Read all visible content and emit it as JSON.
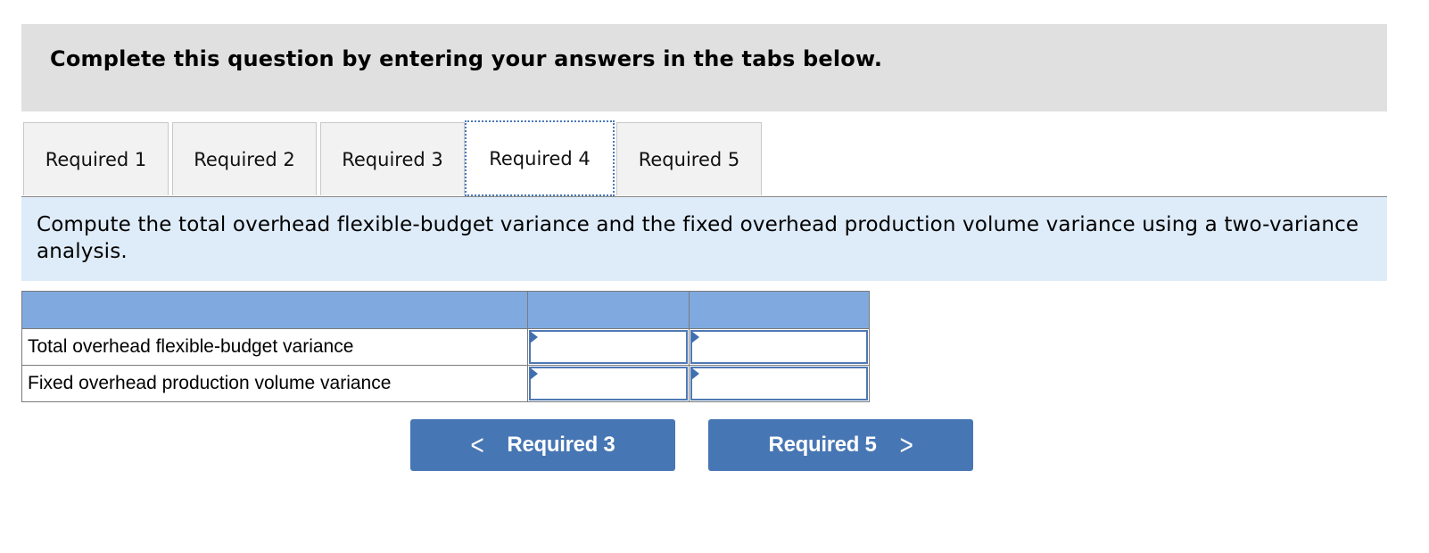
{
  "header": {
    "title": "Complete this question by entering your answers in the tabs below."
  },
  "tabs": [
    {
      "label": "Required 1",
      "active": false
    },
    {
      "label": "Required 2",
      "active": false
    },
    {
      "label": "Required 3",
      "active": false
    },
    {
      "label": "Required 4",
      "active": true
    },
    {
      "label": "Required 5",
      "active": false
    }
  ],
  "instruction": "Compute the total overhead flexible-budget variance and the fixed overhead production volume variance using a two-variance analysis.",
  "table": {
    "header": [
      "",
      "",
      ""
    ],
    "rows": [
      {
        "label": "Total overhead flexible-budget variance",
        "value1": "",
        "value2": ""
      },
      {
        "label": "Fixed overhead production volume variance",
        "value1": "",
        "value2": ""
      }
    ]
  },
  "navigation": {
    "prev": {
      "label": "Required 3",
      "icon": "chevron-left-icon",
      "glyph": "<"
    },
    "next": {
      "label": "Required 5",
      "icon": "chevron-right-icon",
      "glyph": ">"
    }
  },
  "colors": {
    "header_band": "#e0e0e0",
    "instruction_band": "#deebf8",
    "table_header": "#80aadf",
    "button": "#4776b4",
    "input_border": "#4f79b5"
  }
}
